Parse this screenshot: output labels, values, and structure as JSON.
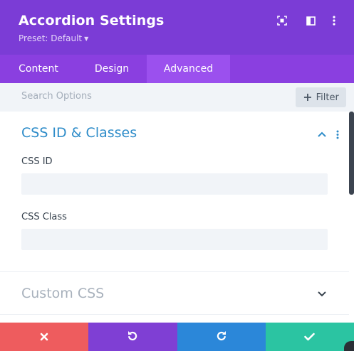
{
  "header": {
    "title": "Accordion Settings",
    "preset_label": "Preset: Default",
    "icons": [
      "expand-icon",
      "sidebar-toggle-icon",
      "more-vertical-icon"
    ],
    "background": "#7b3cd6"
  },
  "tabs": [
    {
      "label": "Content",
      "active": false
    },
    {
      "label": "Design",
      "active": false
    },
    {
      "label": "Advanced",
      "active": true
    }
  ],
  "search": {
    "placeholder": "Search Options",
    "filter_label": "Filter"
  },
  "sections": {
    "css_id_classes": {
      "title": "CSS ID & Classes",
      "expanded": true,
      "fields": {
        "css_id": {
          "label": "CSS ID",
          "value": ""
        },
        "css_class": {
          "label": "CSS Class",
          "value": ""
        }
      }
    },
    "custom_css": {
      "title": "Custom CSS",
      "expanded": false
    }
  },
  "footer": {
    "buttons": [
      {
        "name": "cancel",
        "icon": "close-icon",
        "color": "#ee5c5e"
      },
      {
        "name": "undo",
        "icon": "undo-icon",
        "color": "#7f3fd4"
      },
      {
        "name": "redo",
        "icon": "redo-icon",
        "color": "#2b87d9"
      },
      {
        "name": "save",
        "icon": "check-icon",
        "color": "#2bc4a2"
      }
    ]
  },
  "colors": {
    "accent_blue": "#2e8cc9",
    "tab_bar": "#8a3fe0",
    "tab_active": "#9b50ee"
  }
}
